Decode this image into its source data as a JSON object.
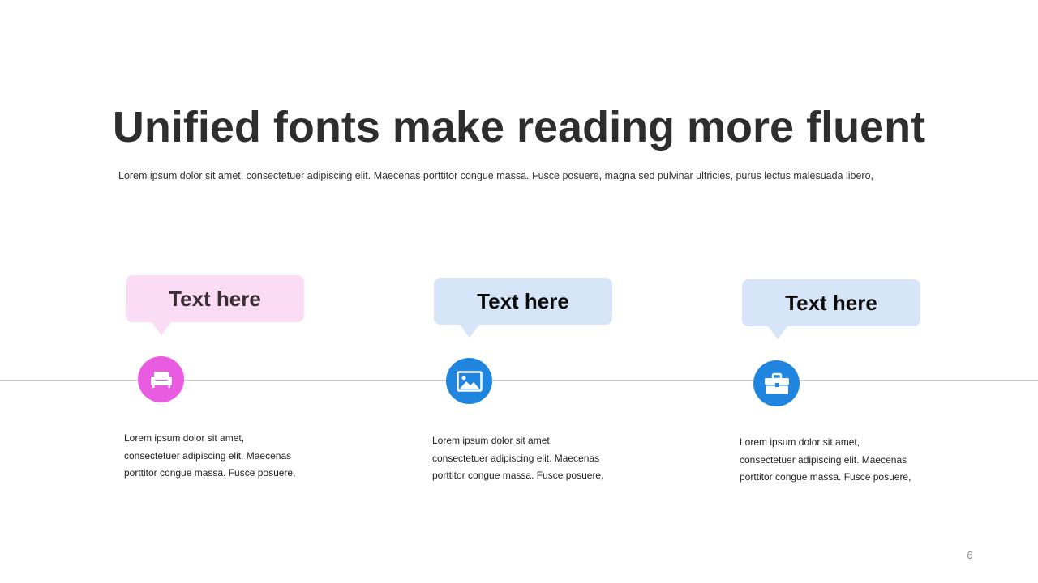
{
  "slide": {
    "title": "Unified fonts make reading more fluent",
    "subtitle": "Lorem ipsum dolor sit amet, consectetuer adipiscing elit. Maecenas porttitor congue massa. Fusce posuere, magna sed pulvinar ultricies, purus lectus malesuada libero,",
    "page_number": "6"
  },
  "items": [
    {
      "heading": "Text here",
      "icon": "sofa-icon",
      "color": "#e95be0",
      "bubble_color": "#fbdcf5",
      "body_line1": "Lorem ipsum dolor sit amet,",
      "body_line2": "consectetuer adipiscing elit. Maecenas",
      "body_line3": "porttitor congue massa. Fusce posuere,"
    },
    {
      "heading": "Text here",
      "icon": "image-icon",
      "color": "#1f85df",
      "bubble_color": "#d6e6f8",
      "body_line1": "Lorem ipsum dolor sit amet,",
      "body_line2": "consectetuer adipiscing elit. Maecenas",
      "body_line3": "porttitor congue massa. Fusce posuere,"
    },
    {
      "heading": "Text here",
      "icon": "briefcase-icon",
      "color": "#1f85df",
      "bubble_color": "#d6e6f8",
      "body_line1": "Lorem ipsum dolor sit amet,",
      "body_line2": "consectetuer adipiscing elit. Maecenas",
      "body_line3": "porttitor congue massa. Fusce posuere,"
    }
  ]
}
